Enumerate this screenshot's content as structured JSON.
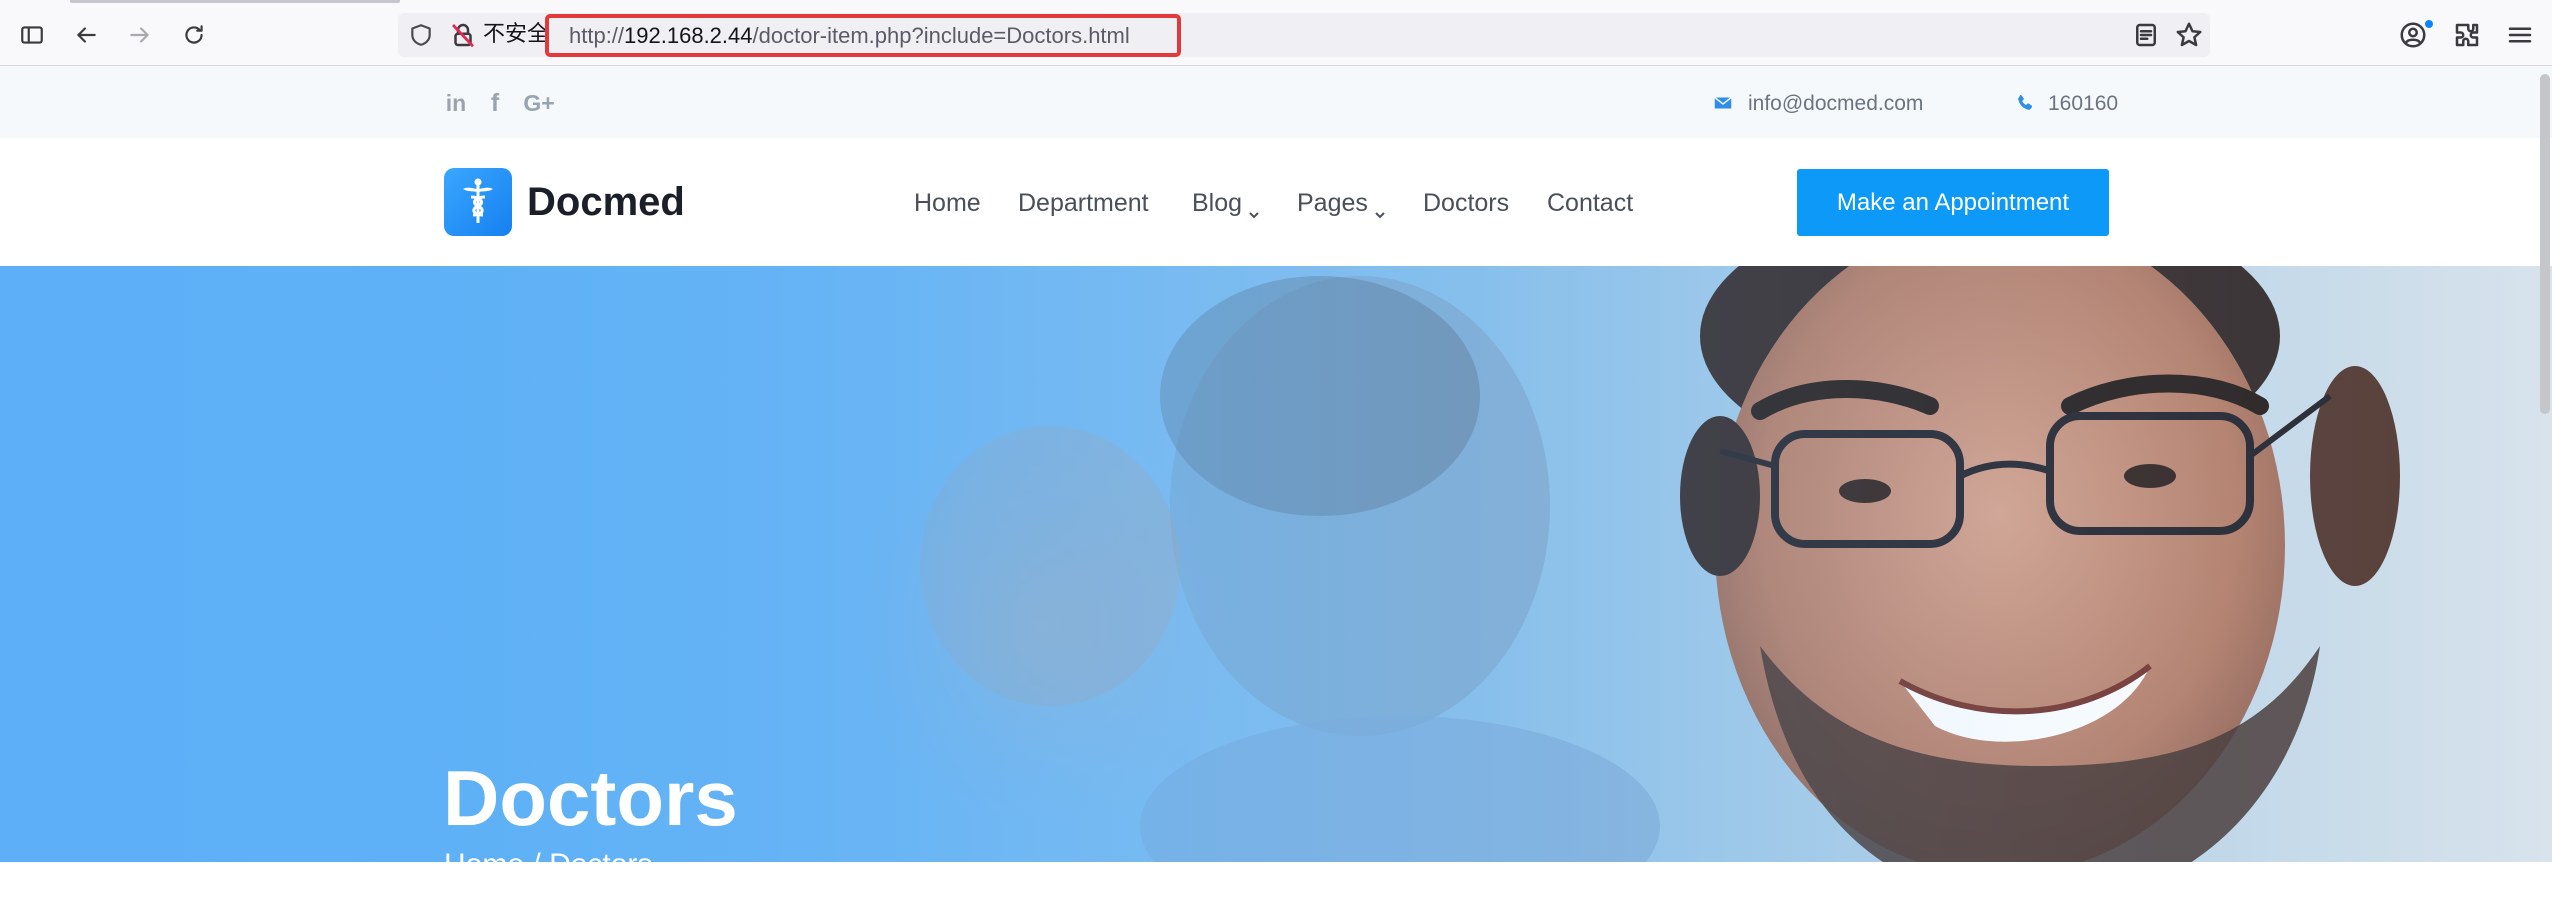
{
  "browser": {
    "security_label": "不安全",
    "url_prefix": "http://",
    "url_host": "192.168.2.44",
    "url_path": "/doctor-item.php?include=Doctors.html",
    "icons": [
      "sidebar-icon",
      "back-icon",
      "forward-icon",
      "reload-icon",
      "shield-icon",
      "insecure-lock-icon",
      "reader-view-icon",
      "bookmark-star-icon",
      "account-icon",
      "extensions-icon",
      "menu-icon"
    ]
  },
  "topbar": {
    "social": {
      "linkedin": "in",
      "facebook": "f",
      "googleplus": "G+"
    },
    "email": "info@docmed.com",
    "phone": "160160"
  },
  "nav": {
    "brand": "Docmed",
    "items": [
      {
        "label": "Home",
        "dropdown": false
      },
      {
        "label": "Department",
        "dropdown": false
      },
      {
        "label": "Blog",
        "dropdown": true
      },
      {
        "label": "Pages",
        "dropdown": true
      },
      {
        "label": "Doctors",
        "dropdown": false
      },
      {
        "label": "Contact",
        "dropdown": false
      }
    ],
    "cta": "Make an Appointment"
  },
  "hero": {
    "title": "Doctors",
    "breadcrumb_home": "Home",
    "breadcrumb_sep": "/",
    "breadcrumb_current": "Doctors"
  },
  "colors": {
    "accent": "#0d99f8",
    "url_highlight": "#e23a3a",
    "hero_blue": "#5db0f7"
  }
}
